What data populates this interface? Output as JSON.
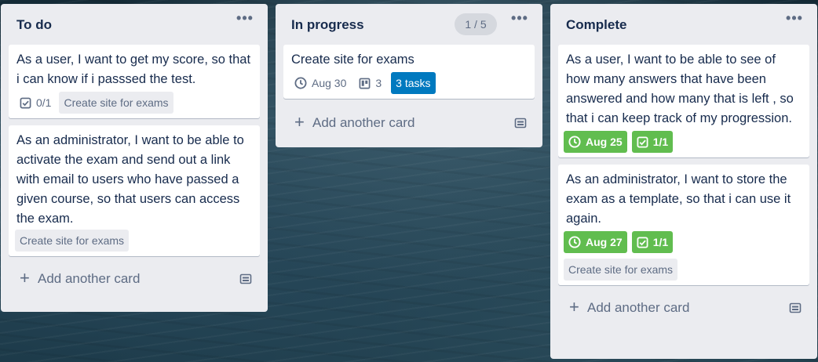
{
  "board": {
    "lists": [
      {
        "title": "To do",
        "menu_icon": "ellipsis-icon",
        "add_card_label": "Add another card",
        "cards": [
          {
            "title": "As a user, I want to get my score, so that i can know if i passsed the test.",
            "checklist": "0/1",
            "label": "Create site for exams"
          },
          {
            "title": "As an administrator, I want to be able to activate the exam and send out a link with email to users who have passed a given course, so that users can access the exam.",
            "label": "Create site for exams"
          }
        ]
      },
      {
        "title": "In progress",
        "wip_limit": "1 / 5",
        "menu_icon": "ellipsis-icon",
        "add_card_label": "Add another card",
        "cards": [
          {
            "title": "Create site for exams",
            "due": "Aug 30",
            "child_count": "3",
            "tasks_badge": "3 tasks"
          }
        ]
      },
      {
        "title": "Complete",
        "menu_icon": "ellipsis-icon",
        "add_card_label": "Add another card",
        "cards": [
          {
            "title": "As a user, I want to be able to see of how many answers that have been answered and how many that is left , so that i can keep track of my progression.",
            "due": "Aug 25",
            "checklist": "1/1"
          },
          {
            "title": "As an administrator, I want to store the exam as a template, so that i can use it again.",
            "due": "Aug 27",
            "checklist": "1/1",
            "label": "Create site for exams"
          }
        ]
      }
    ]
  },
  "glyphs": {
    "menu": "•••",
    "plus": "+"
  },
  "colors": {
    "list_bg": "#ebecf0",
    "card_bg": "#ffffff",
    "text": "#172b4d",
    "muted": "#5e6c84",
    "green_badge": "#61bd4f",
    "blue_badge": "#0079bf"
  }
}
